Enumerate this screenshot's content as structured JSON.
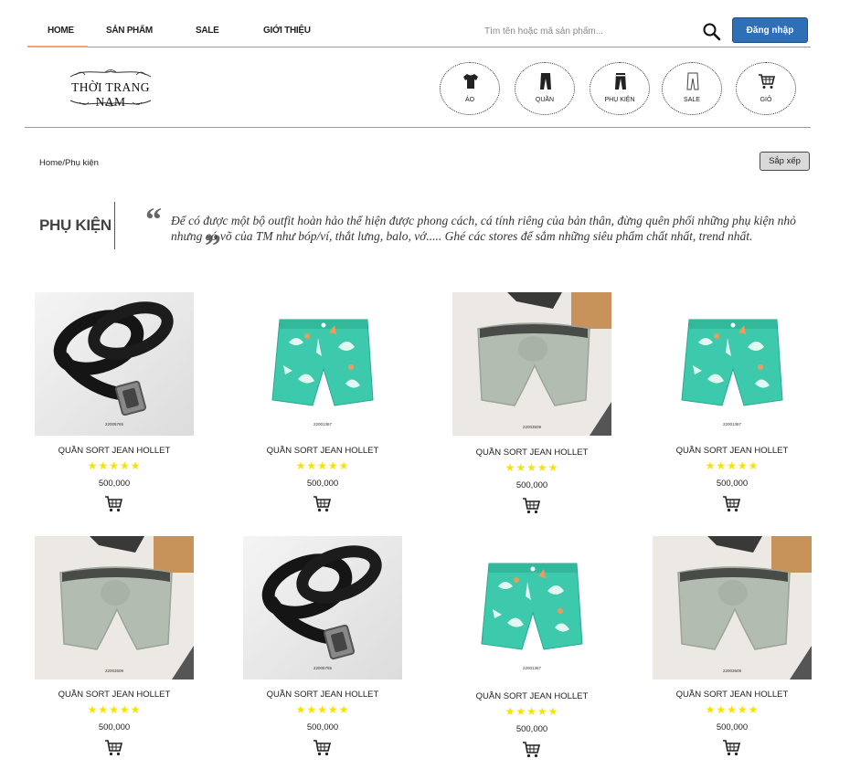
{
  "nav": {
    "items": [
      "HOME",
      "SẢN PHẨM",
      "SALE",
      "GIỚI THIỆU"
    ],
    "active": "HOME",
    "search_placeholder": "Tìm tên hoặc mã sản phẩm...",
    "login_label": "Đăng nhập"
  },
  "brand": {
    "logo_text": "THỜI TRANG NAM"
  },
  "categories": [
    {
      "label": "ÁO",
      "icon": "shirt-icon"
    },
    {
      "label": "QUẦN",
      "icon": "pants-icon"
    },
    {
      "label": "PHỤ KIỆN",
      "icon": "accessory-icon"
    },
    {
      "label": "SALE",
      "icon": "sale-pants-icon"
    },
    {
      "label": "GIỎ",
      "icon": "cart-icon"
    }
  ],
  "breadcrumb": "Home/Phụ kiện",
  "sort_label": "Sắp xếp",
  "page": {
    "title": "PHỤ KIỆN",
    "intro": "Để có được một bộ outfit hoàn hảo thể hiện được phong cách, cá tính riêng của bản thân, đừng quên phối những phụ kiện nhỏ nhưng có võ của TM như bóp/ví, thắt lưng, balo, vớ..... Ghé các stores để sắm những siêu phẩm chất nhất, trend nhất."
  },
  "colors": {
    "accent_blue": "#2f6fb5",
    "star": "#f5e400",
    "nav_underline": "#e8a67e"
  },
  "products": [
    {
      "name": "QUẦN SORT JEAN HOLLET",
      "rating": 5,
      "stars": "★★★★★",
      "price": "500,000",
      "image": "belt",
      "code": "22005765"
    },
    {
      "name": "QUẦN SORT JEAN HOLLET",
      "rating": 5,
      "stars": "★★★★★",
      "price": "500,000",
      "image": "shorts",
      "code": "22001367"
    },
    {
      "name": "QUẦN SORT JEAN HOLLET",
      "rating": 5,
      "stars": "★★★★★",
      "price": "500,000",
      "image": "briefs",
      "code": "22003509"
    },
    {
      "name": "QUẦN SORT JEAN HOLLET",
      "rating": 5,
      "stars": "★★★★★",
      "price": "500,000",
      "image": "shorts",
      "code": "22001367"
    },
    {
      "name": "QUẦN SORT JEAN HOLLET",
      "rating": 5,
      "stars": "★★★★★",
      "price": "500,000",
      "image": "briefs",
      "code": "22003509"
    },
    {
      "name": "QUẦN SORT JEAN HOLLET",
      "rating": 5,
      "stars": "★★★★★",
      "price": "500,000",
      "image": "belt",
      "code": "22005765"
    },
    {
      "name": "QUẦN SORT JEAN HOLLET",
      "rating": 5,
      "stars": "★★★★★",
      "price": "500,000",
      "image": "shorts",
      "code": "22001367"
    },
    {
      "name": "QUẦN SORT JEAN HOLLET",
      "rating": 5,
      "stars": "★★★★★",
      "price": "500,000",
      "image": "briefs",
      "code": "22003509"
    }
  ]
}
